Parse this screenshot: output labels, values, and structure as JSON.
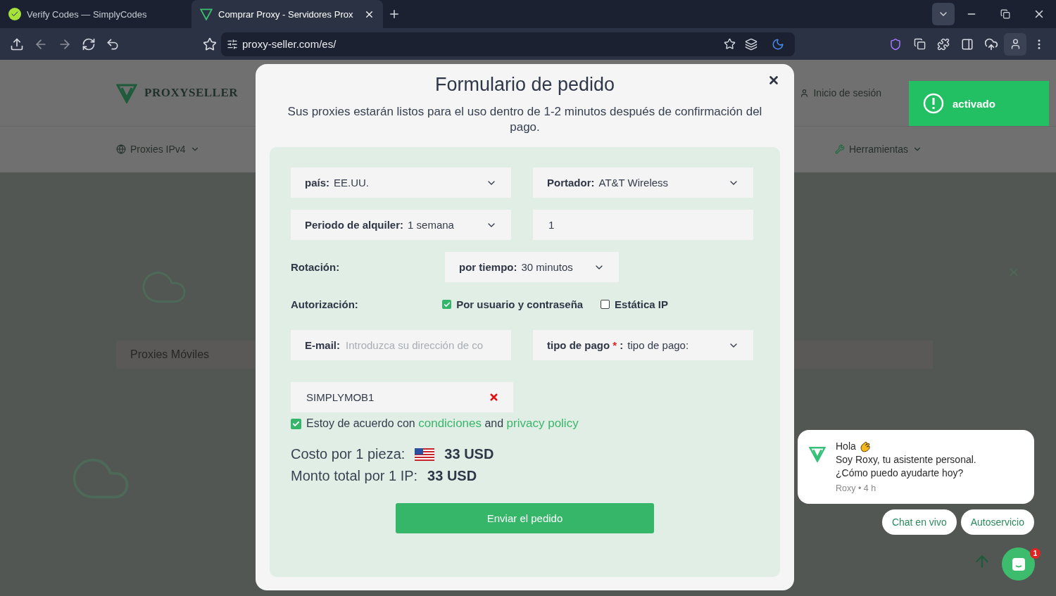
{
  "browser": {
    "tabs": [
      {
        "title": "Verify Codes — SimplyCodes",
        "selected": false
      },
      {
        "title": "Comprar Proxy - Servidores Prox",
        "selected": true
      }
    ],
    "url": "proxy-seller.com/es/"
  },
  "site": {
    "logo": "PROXYSELLER",
    "login": "Inicio de sesión",
    "nav": [
      "Proxies IPv4",
      "Herramientas"
    ],
    "card": "Proxies Móviles"
  },
  "toast": {
    "text": "activado"
  },
  "modal": {
    "title": "Formulario de pedido",
    "subtitle": "Sus proxies estarán listos para el uso dentro de 1-2 minutos después de confirmación del pago.",
    "fields": [
      {
        "kind": "select",
        "label": "país:",
        "value": "EE.UU."
      },
      {
        "kind": "select",
        "label": "Portador:",
        "value": "AT&T Wireless"
      },
      {
        "kind": "select",
        "label": "Periodo de alquiler:",
        "value": "1 semana"
      },
      {
        "kind": "input",
        "value": "1"
      }
    ],
    "rotation": {
      "label": "Rotación:",
      "select_label": "por tiempo:",
      "value": "30 minutos"
    },
    "authorization": {
      "label": "Autorización:",
      "options": [
        {
          "label": "Por usuario y contraseña",
          "checked": true
        },
        {
          "label": "Estática IP",
          "checked": false
        }
      ]
    },
    "email": {
      "label": "E-mail:",
      "placeholder": "Introduzca su dirección de co"
    },
    "payment": {
      "label": "tipo de pago",
      "required_mark": "*",
      "separator": ":",
      "value": "tipo de pago:"
    },
    "coupon": {
      "value": "SIMPLYMOB1"
    },
    "agreement": {
      "checked": true,
      "text": "Estoy de acuerdo con",
      "link1": "condiciones",
      "joiner": "and",
      "link2": "privacy policy"
    },
    "costs": [
      {
        "label": "Costo por 1 pieza:",
        "flag": true,
        "value": "33 USD"
      },
      {
        "label": "Monto total por 1 IP:",
        "flag": false,
        "value": "33 USD"
      }
    ],
    "submit": "Enviar el pedido"
  },
  "chat": {
    "greeting": "Hola",
    "lines": [
      "Soy Roxy, tu asistente personal.",
      "¿Cómo puedo ayudarte hoy?"
    ],
    "meta": "Roxy • 4 h",
    "buttons": [
      "Chat en vivo",
      "Autoservicio"
    ],
    "badge": "1"
  }
}
